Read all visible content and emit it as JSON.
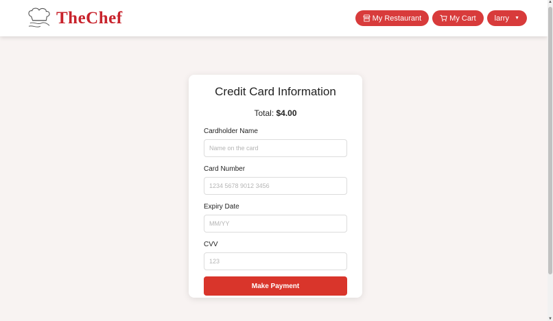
{
  "brand": {
    "name": "TheChef",
    "color": "#c8232c"
  },
  "nav": {
    "my_restaurant": "My Restaurant",
    "my_cart": "My Cart",
    "user": "larry",
    "button_color": "#d83b3b"
  },
  "card": {
    "title": "Credit Card Information",
    "total_label": "Total:",
    "total_value": "$4.00",
    "fields": {
      "cardholder": {
        "label": "Cardholder Name",
        "placeholder": "Name on the card",
        "value": ""
      },
      "card_number": {
        "label": "Card Number",
        "placeholder": "1234 5678 9012 3456",
        "value": ""
      },
      "expiry": {
        "label": "Expiry Date",
        "placeholder": "MM/YY",
        "value": ""
      },
      "cvv": {
        "label": "CVV",
        "placeholder": "123",
        "value": ""
      }
    },
    "pay_button": "Make Payment",
    "pay_color": "#d9352b"
  }
}
